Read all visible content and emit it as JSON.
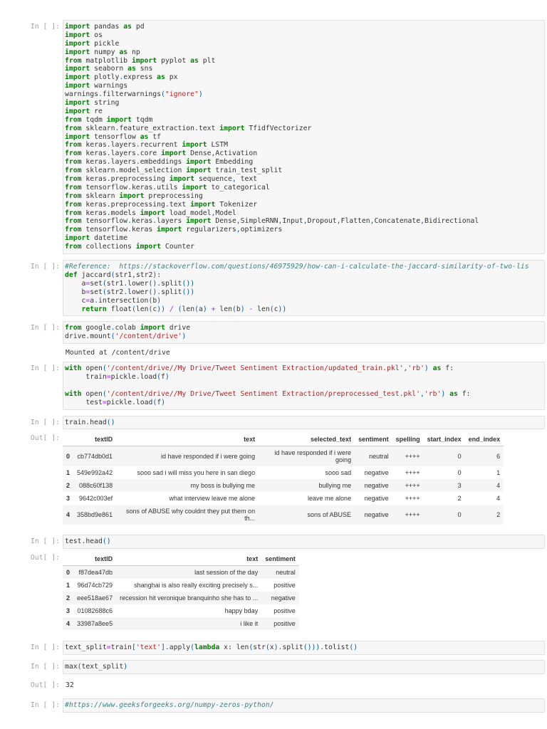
{
  "prompts": {
    "in": "In [ ]:",
    "out": "Out[ ]:"
  },
  "cells": [
    {
      "kind": "code",
      "lines": [
        "import pandas as pd",
        "import os",
        "import pickle",
        "import numpy as np",
        "from matplotlib import pyplot as plt",
        "import seaborn as sns",
        "import plotly.express as px",
        "import warnings",
        "warnings.filterwarnings(\"ignore\")",
        "import string",
        "import re",
        "from tqdm import tqdm",
        "from sklearn.feature_extraction.text import TfidfVectorizer",
        "import tensorflow as tf",
        "from keras.layers.recurrent import LSTM",
        "from keras.layers.core import Dense,Activation",
        "from keras.layers.embeddings import Embedding",
        "from sklearn.model_selection import train_test_split",
        "from keras.preprocessing import sequence, text",
        "from tensorflow.keras.utils import to_categorical",
        "from sklearn import preprocessing",
        "from keras.preprocessing.text import Tokenizer",
        "from keras.models import load_model,Model",
        "from tensorflow.keras.layers import Dense,SimpleRNN,Input,Dropout,Flatten,Concatenate,Bidirectional",
        "from tensorflow.keras import regularizers,optimizers",
        "import datetime",
        "from collections import Counter"
      ]
    },
    {
      "kind": "code",
      "lines": [
        "#Reference:  https://stackoverflow.com/questions/46975929/how-can-i-calculate-the-jaccard-similarity-of-two-lis",
        "def jaccard(str1,str2):",
        "    a=set(str1.lower().split())",
        "    b=set(str2.lower().split())",
        "    c=a.intersection(b)",
        "    return float(len(c)) / (len(a) + len(b) - len(c))"
      ]
    },
    {
      "kind": "code",
      "lines": [
        "from google.colab import drive",
        "drive.mount('/content/drive')"
      ]
    },
    {
      "kind": "stream",
      "text": "Mounted at /content/drive"
    },
    {
      "kind": "code",
      "lines": [
        "with open('/content/drive//My Drive/Tweet Sentiment Extraction/updated_train.pkl','rb') as f:",
        "     train=pickle.load(f)",
        "",
        "with open('/content/drive//My Drive/Tweet Sentiment Extraction/preprocessed_test.pkl','rb') as f:",
        "     test=pickle.load(f)"
      ]
    },
    {
      "kind": "code",
      "lines": [
        "train.head()"
      ]
    },
    {
      "kind": "table",
      "columns": [
        "",
        "textID",
        "text",
        "selected_text",
        "sentiment",
        "spelling",
        "start_index",
        "end_index"
      ],
      "rows": [
        [
          "0",
          "cb774db0d1",
          "id have responded if i were going",
          "id have responded if i were going",
          "neutral",
          "++++",
          "0",
          "6"
        ],
        [
          "1",
          "549e992a42",
          "sooo sad i will miss you here in san diego",
          "sooo sad",
          "negative",
          "++++",
          "0",
          "1"
        ],
        [
          "2",
          "088c60f138",
          "my boss is bullying me",
          "bullying me",
          "negative",
          "++++",
          "3",
          "4"
        ],
        [
          "3",
          "9642c003ef",
          "what interview leave me alone",
          "leave me alone",
          "negative",
          "++++",
          "2",
          "4"
        ],
        [
          "4",
          "358bd9e861",
          "sons of ABUSE why couldnt they put them on th...",
          "sons of ABUSE",
          "negative",
          "++++",
          "0",
          "2"
        ]
      ]
    },
    {
      "kind": "code",
      "lines": [
        "test.head()"
      ]
    },
    {
      "kind": "table",
      "columns": [
        "",
        "textID",
        "text",
        "sentiment"
      ],
      "rows": [
        [
          "0",
          "f87dea47db",
          "last session of the day",
          "neutral"
        ],
        [
          "1",
          "96d74cb729",
          "shanghai is also really exciting precisely s...",
          "positive"
        ],
        [
          "2",
          "eee518ae67",
          "recession hit veronique branquinho she has to ...",
          "negative"
        ],
        [
          "3",
          "01082688c6",
          "happy bday",
          "positive"
        ],
        [
          "4",
          "33987a8ee5",
          "i like it",
          "positive"
        ]
      ]
    },
    {
      "kind": "code",
      "lines": [
        "text_split=train['text'].apply(lambda x: len(str(x).split())).tolist()"
      ]
    },
    {
      "kind": "code",
      "lines": [
        "max(text_split)"
      ]
    },
    {
      "kind": "result",
      "text": "32"
    },
    {
      "kind": "code",
      "lines": [
        "#https://www.geeksforgeeks.org/numpy-zeros-python/"
      ]
    }
  ]
}
